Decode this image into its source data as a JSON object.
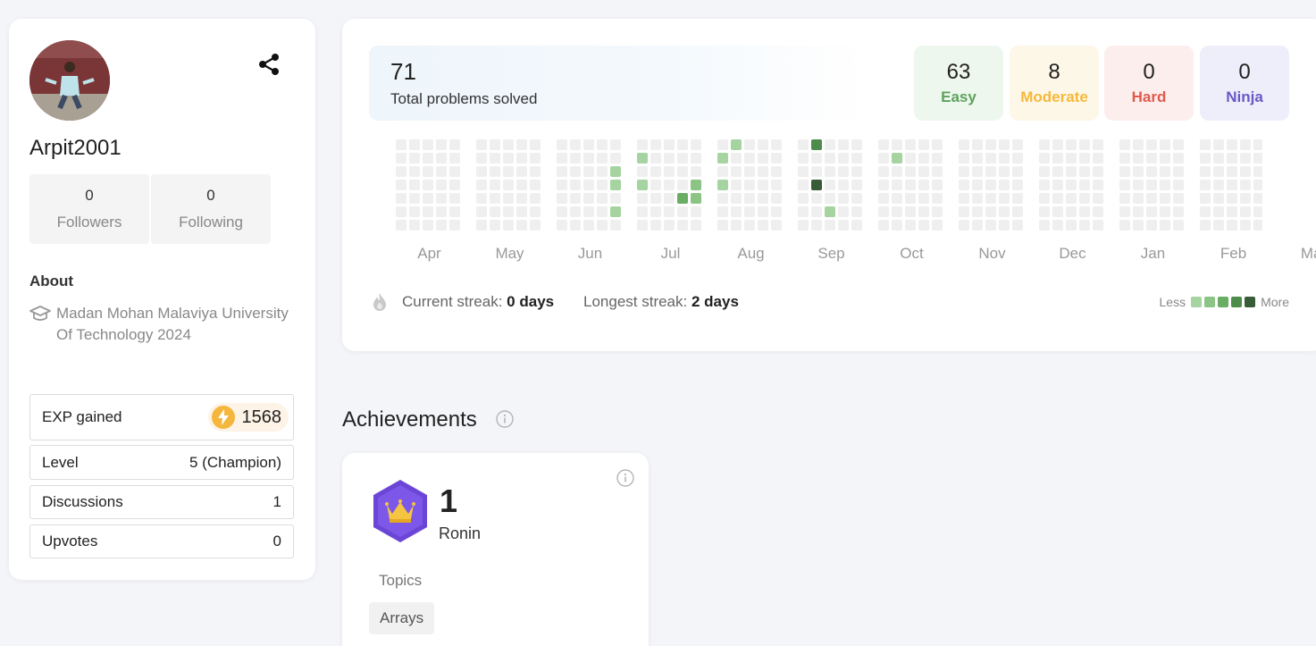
{
  "profile": {
    "username": "Arpit2001",
    "followers": {
      "count": "0",
      "label": "Followers"
    },
    "following": {
      "count": "0",
      "label": "Following"
    },
    "about_title": "About",
    "school": "Madan Mohan Malaviya University Of Technology 2024",
    "stats": {
      "exp_label": "EXP gained",
      "exp_value": "1568",
      "level_label": "Level",
      "level_value": "5 (Champion)",
      "discussions_label": "Discussions",
      "discussions_value": "1",
      "upvotes_label": "Upvotes",
      "upvotes_value": "0"
    }
  },
  "summary": {
    "total": "71",
    "total_label": "Total problems solved",
    "easy": {
      "count": "63",
      "label": "Easy",
      "color": "#5da35d"
    },
    "moderate": {
      "count": "8",
      "label": "Moderate",
      "color": "#f5b93b"
    },
    "hard": {
      "count": "0",
      "label": "Hard",
      "color": "#e05a4e"
    },
    "ninja": {
      "count": "0",
      "label": "Ninja",
      "color": "#6a58c4"
    }
  },
  "heatmap": {
    "months": [
      "Apr",
      "May",
      "Jun",
      "Jul",
      "Aug",
      "Sep",
      "Oct",
      "Nov",
      "Dec",
      "Jan",
      "Feb",
      "Mar"
    ],
    "colors": {
      "empty": "#efefef",
      "l1": "#a5d4a0",
      "l2": "#8cc485",
      "l3": "#6aae64",
      "l4": "#4d8c4b",
      "l5": "#385c38"
    },
    "active_cells": [
      {
        "week": 21,
        "day": 0,
        "level": "l1"
      },
      {
        "week": 15,
        "day": 1,
        "level": "l1"
      },
      {
        "week": 20,
        "day": 1,
        "level": "l1"
      },
      {
        "week": 31,
        "day": 1,
        "level": "l1"
      },
      {
        "week": 14,
        "day": 2,
        "level": "l1"
      },
      {
        "week": 14,
        "day": 3,
        "level": "l1"
      },
      {
        "week": 15,
        "day": 3,
        "level": "l1"
      },
      {
        "week": 19,
        "day": 3,
        "level": "l2"
      },
      {
        "week": 20,
        "day": 3,
        "level": "l1"
      },
      {
        "week": 18,
        "day": 4,
        "level": "l3"
      },
      {
        "week": 19,
        "day": 4,
        "level": "l2"
      },
      {
        "week": 14,
        "day": 5,
        "level": "l1"
      },
      {
        "week": 27,
        "day": 5,
        "level": "l1"
      },
      {
        "week": 59,
        "day": 5,
        "level": "l1"
      },
      {
        "week": 26,
        "day": 0,
        "level": "l4"
      },
      {
        "week": 26,
        "day": 3,
        "level": "l5"
      }
    ],
    "streak": {
      "current_label": "Current streak:",
      "current_value": "0 days",
      "longest_label": "Longest streak:",
      "longest_value": "2 days"
    },
    "legend_less": "Less",
    "legend_more": "More"
  },
  "achievements": {
    "title": "Achievements",
    "count": "1",
    "rank": "Ronin",
    "topics_label": "Topics",
    "topics": [
      "Arrays"
    ]
  }
}
